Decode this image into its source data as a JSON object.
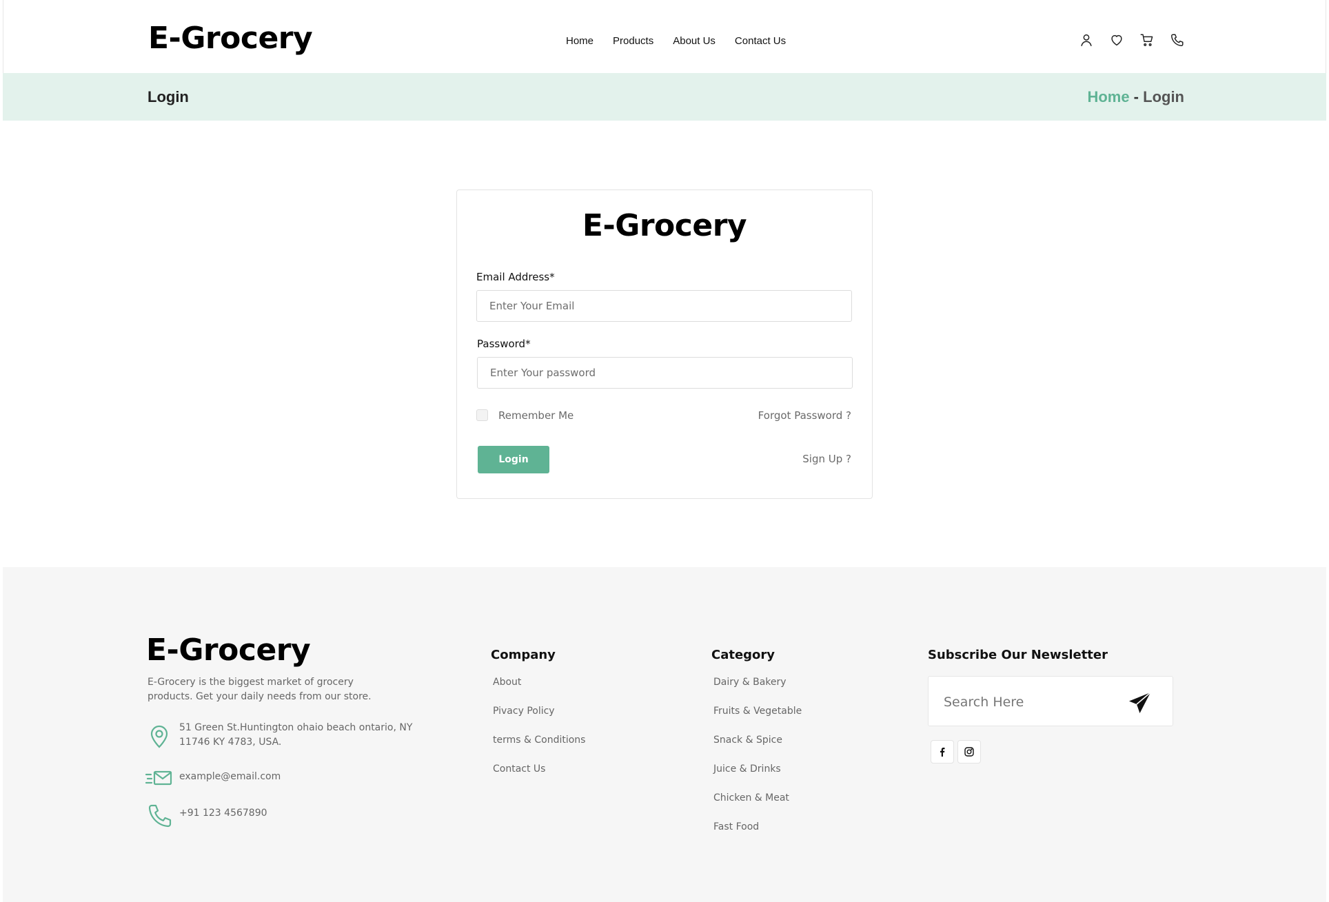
{
  "header": {
    "logo": "E-Grocery",
    "nav": [
      "Home",
      "Products",
      "About Us",
      "Contact Us"
    ],
    "icons": [
      "user-icon",
      "heart-icon",
      "cart-icon",
      "phone-icon"
    ]
  },
  "breadcrumb": {
    "title": "Login",
    "home": "Home",
    "separator": " - ",
    "current": "Login"
  },
  "login": {
    "logo": "E-Grocery",
    "email_label": "Email Address*",
    "email_placeholder": "Enter Your Email",
    "password_label": "Password*",
    "password_placeholder": "Enter Your password",
    "remember": "Remember Me",
    "forgot": "Forgot Password ?",
    "login_button": "Login",
    "signup": "Sign Up ?"
  },
  "footer": {
    "logo": "E-Grocery",
    "description": "E-Grocery is the biggest market of grocery products. Get your daily needs from our store.",
    "address": "51 Green St.Huntington ohaio beach ontario, NY 11746 KY 4783, USA.",
    "email": "example@email.com",
    "phone": "+91 123 4567890",
    "company": {
      "title": "Company",
      "items": [
        "About",
        "Pivacy Policy",
        "terms & Conditions",
        "Contact Us"
      ]
    },
    "category": {
      "title": "Category",
      "items": [
        "Dairy & Bakery",
        "Fruits & Vegetable",
        "Snack & Spice",
        "Juice & Drinks",
        "Chicken & Meat",
        "Fast Food"
      ]
    },
    "newsletter": {
      "title": "Subscribe Our Newsletter",
      "placeholder": "Search Here"
    },
    "social": [
      "facebook-icon",
      "instagram-icon"
    ]
  },
  "colors": {
    "accent": "#5fb394",
    "breadcrumb_bg": "#e3f2ec",
    "footer_bg": "#f6f6f6"
  }
}
